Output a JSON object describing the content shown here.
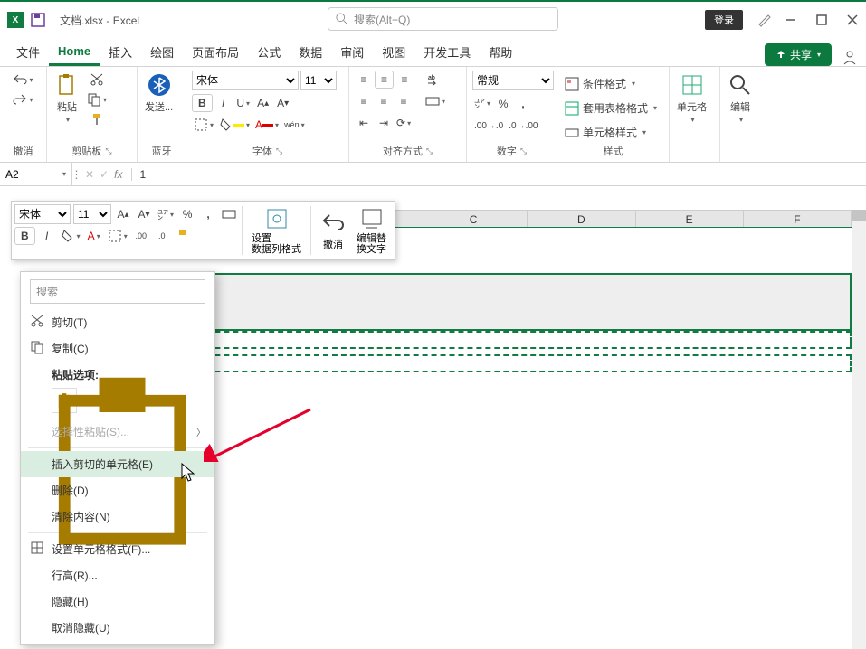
{
  "title": {
    "filename": "文档.xlsx",
    "sep": " - ",
    "app": "Excel"
  },
  "search": {
    "placeholder": "搜索(Alt+Q)"
  },
  "login_label": "登录",
  "tabs": {
    "file": "文件",
    "home": "Home",
    "insert": "插入",
    "draw": "绘图",
    "layout": "页面布局",
    "formulas": "公式",
    "data": "数据",
    "review": "审阅",
    "view": "视图",
    "developer": "开发工具",
    "help": "帮助"
  },
  "share_label": "共享",
  "ribbon": {
    "undo": {
      "group_label": "撤消"
    },
    "clipboard": {
      "paste": "粘贴",
      "group_label": "剪贴板"
    },
    "bluetooth": {
      "send": "发送...",
      "group_label": "蓝牙"
    },
    "font": {
      "name": "宋体",
      "size": "11",
      "group_label": "字体"
    },
    "align": {
      "group_label": "对齐方式"
    },
    "number": {
      "format": "常规",
      "group_label": "数字"
    },
    "styles": {
      "cond_format": "条件格式",
      "table_format": "套用表格格式",
      "cell_style": "单元格样式",
      "group_label": "样式"
    },
    "cells": {
      "label": "单元格"
    },
    "editing": {
      "label": "编辑"
    }
  },
  "name_box": "A2",
  "formula_value": "1",
  "mini_toolbar": {
    "font": "宋体",
    "size": "11",
    "set_data_format": "设置数据列格式",
    "set_data_format_sub": "",
    "undo_label": "撤消",
    "alt_text": "编辑替换文字"
  },
  "columns": [
    "C",
    "D",
    "E",
    "F"
  ],
  "context_menu": {
    "search_placeholder": "搜索",
    "cut": "剪切(T)",
    "copy": "复制(C)",
    "paste_options_label": "粘贴选项:",
    "paste_special": "选择性粘贴(S)...",
    "insert_cut": "插入剪切的单元格(E)",
    "delete": "删除(D)",
    "clear": "清除内容(N)",
    "format_cells": "设置单元格格式(F)...",
    "row_height": "行高(R)...",
    "hide": "隐藏(H)",
    "unhide": "取消隐藏(U)"
  },
  "chart_data": null
}
